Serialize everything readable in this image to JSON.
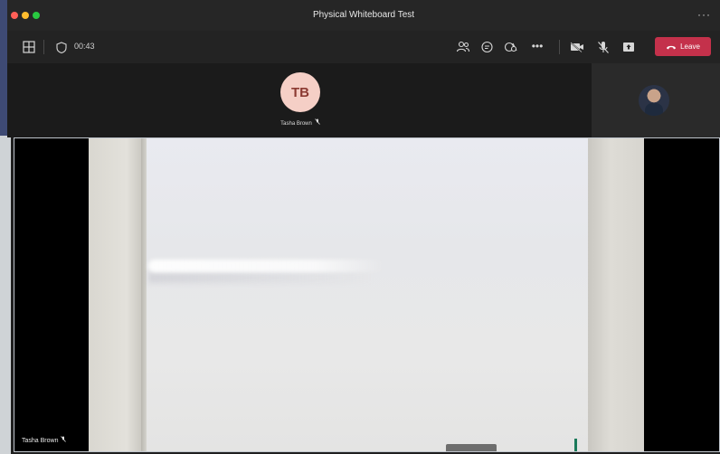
{
  "window": {
    "title": "Physical Whiteboard Test",
    "more_icon": "more-horizontal-icon"
  },
  "toolbar": {
    "timer": "00:43",
    "leave_label": "Leave",
    "icons": [
      "grid-layout-icon",
      "shield-icon",
      "participants-icon",
      "chat-icon",
      "reactions-icon",
      "more-icon",
      "camera-off-icon",
      "mic-off-icon",
      "share-icon",
      "phone-hangup-icon"
    ],
    "leave_color": "#c4314b"
  },
  "participants": {
    "top": {
      "initials": "TB",
      "name": "Tasha Brown"
    },
    "video": {
      "name": "Tasha Brown"
    }
  }
}
